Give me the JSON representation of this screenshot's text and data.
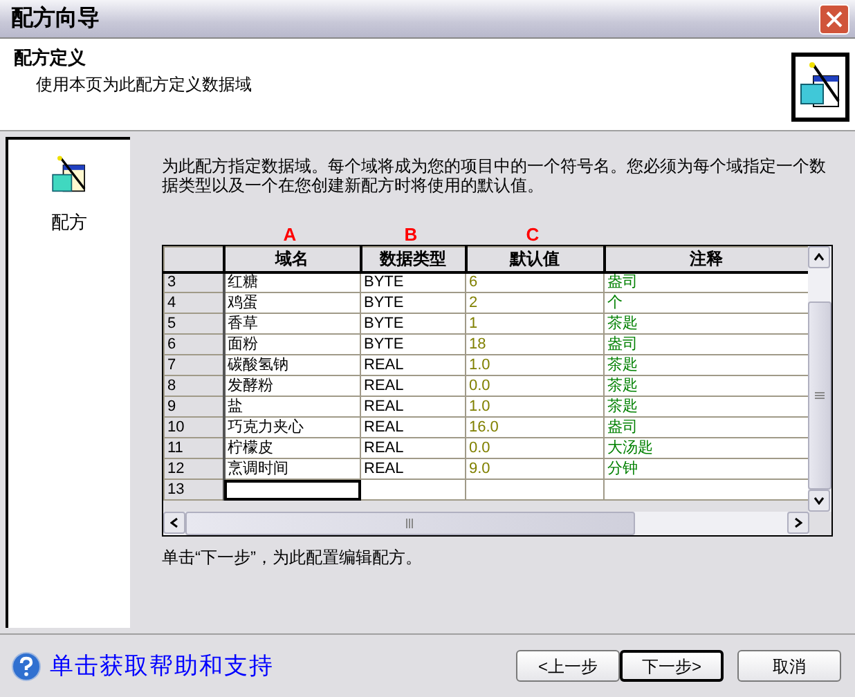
{
  "window": {
    "title": "配方向导"
  },
  "header": {
    "title": "配方定义",
    "subtitle": "使用本页为此配方定义数据域"
  },
  "sidebar": {
    "items": [
      {
        "label": "配方",
        "selected": true
      }
    ]
  },
  "intro": "为此配方指定数据域。每个域将成为您的项目中的一个符号名。您必须为每个域指定一个数据类型以及一个在您创建新配方时将使用的默认值。",
  "table": {
    "markers": [
      "A",
      "B",
      "C"
    ],
    "columns": [
      "域名",
      "数据类型",
      "默认值",
      "注释"
    ],
    "rows": [
      {
        "row": "3",
        "name": "红糖",
        "type": "BYTE",
        "default": "6",
        "note": "盎司",
        "editing": false
      },
      {
        "row": "4",
        "name": "鸡蛋",
        "type": "BYTE",
        "default": "2",
        "note": "个",
        "editing": false
      },
      {
        "row": "5",
        "name": "香草",
        "type": "BYTE",
        "default": "1",
        "note": "茶匙",
        "editing": false
      },
      {
        "row": "6",
        "name": "面粉",
        "type": "BYTE",
        "default": "18",
        "note": "盎司",
        "editing": false
      },
      {
        "row": "7",
        "name": "碳酸氢钠",
        "type": "REAL",
        "default": "1.0",
        "note": "茶匙",
        "editing": false
      },
      {
        "row": "8",
        "name": "发酵粉",
        "type": "REAL",
        "default": "0.0",
        "note": "茶匙",
        "editing": false
      },
      {
        "row": "9",
        "name": "盐",
        "type": "REAL",
        "default": "1.0",
        "note": "茶匙",
        "editing": false
      },
      {
        "row": "10",
        "name": "巧克力夹心",
        "type": "REAL",
        "default": "16.0",
        "note": "盎司",
        "editing": false
      },
      {
        "row": "11",
        "name": "柠檬皮",
        "type": "REAL",
        "default": "0.0",
        "note": "大汤匙",
        "editing": false
      },
      {
        "row": "12",
        "name": "烹调时间",
        "type": "REAL",
        "default": "9.0",
        "note": "分钟",
        "editing": false
      },
      {
        "row": "13",
        "editing": true
      }
    ]
  },
  "hint": "单击“下一步”，为此配置编辑配方。",
  "footer": {
    "help_link": "单击获取帮助和支持",
    "buttons": [
      {
        "label": "<上一步",
        "default": false
      },
      {
        "label": "下一步>",
        "default": true
      },
      {
        "label": "取消",
        "default": false
      }
    ]
  }
}
